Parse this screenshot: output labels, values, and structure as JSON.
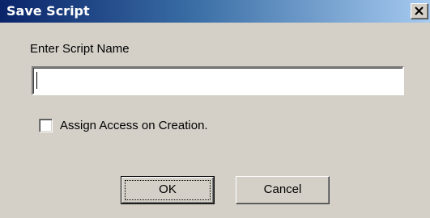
{
  "window": {
    "title": "Save Script",
    "close_glyph": "×"
  },
  "form": {
    "name_label": "Enter Script Name",
    "name_value": "",
    "checkbox_label": "Assign Access on Creation.",
    "checkbox_checked": false
  },
  "buttons": {
    "ok_label": "OK",
    "cancel_label": "Cancel"
  },
  "colors": {
    "titlebar_start": "#0a246a",
    "titlebar_end": "#a6caf0",
    "dialog_bg": "#d4d0c8"
  }
}
